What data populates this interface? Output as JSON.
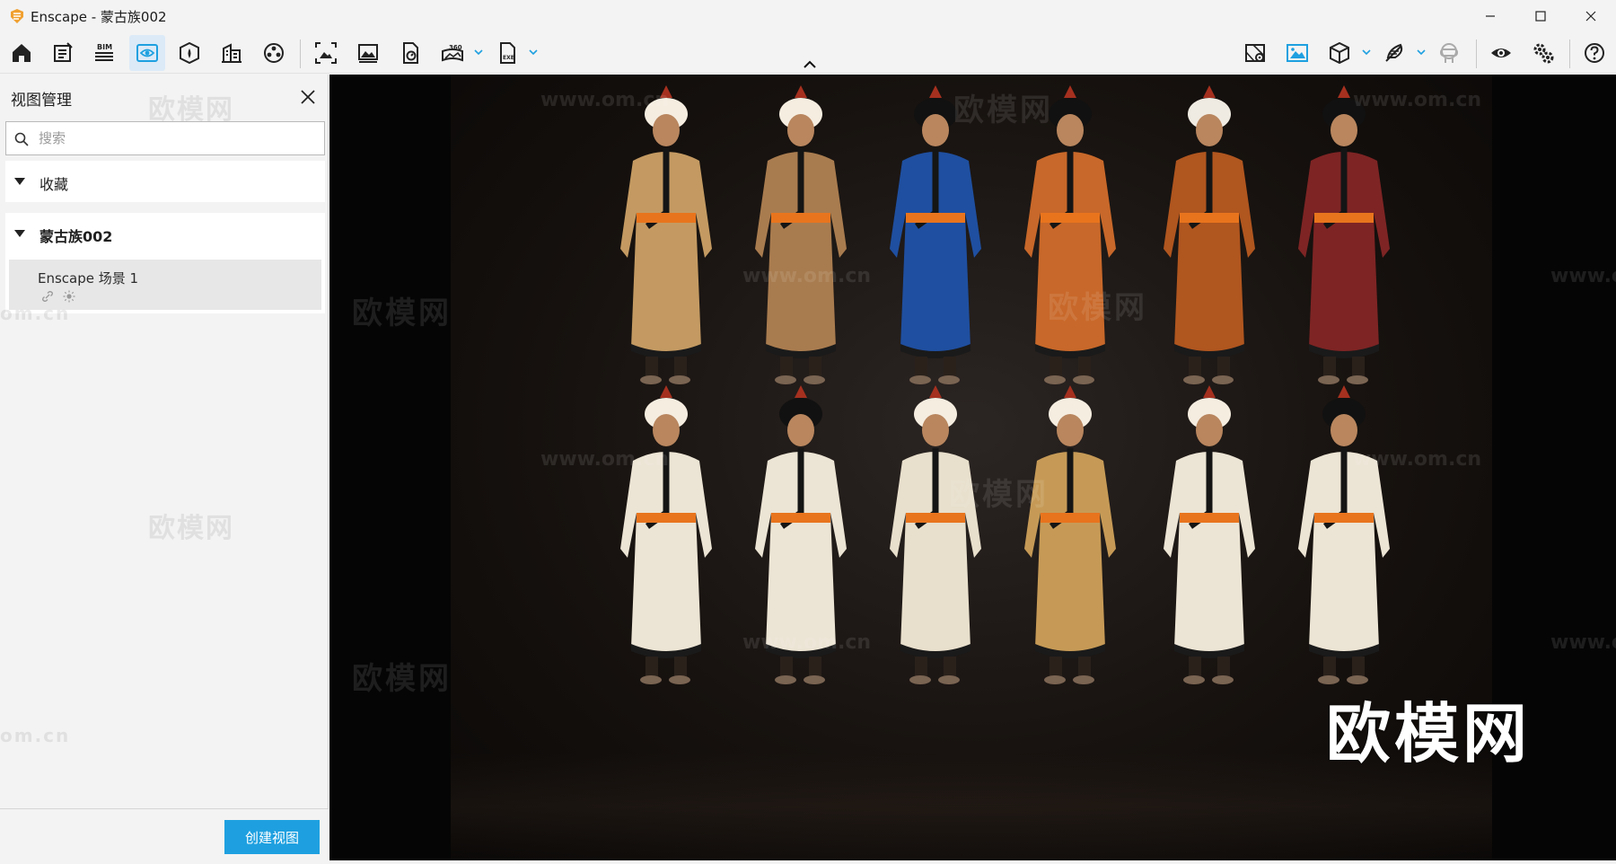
{
  "window": {
    "title": "Enscape - 蒙古族002"
  },
  "panel": {
    "title": "视图管理",
    "search_placeholder": "搜索",
    "sections": [
      {
        "label": "收藏"
      },
      {
        "label": "蒙古族002",
        "items": [
          {
            "name": "Enscape 场景 1"
          }
        ]
      }
    ],
    "create_button": "创建视图"
  },
  "toolbar": {
    "bim_badge": "BIM",
    "pano_badge": "360",
    "exe_badge": "EXE"
  },
  "watermarks": {
    "brand": "欧模网",
    "url": "www.om.cn",
    "url_short": "om.cn"
  },
  "colors": {
    "accent": "#1ea0e0",
    "active_tool_bg": "#dceaf7",
    "logo": "#f0a030"
  },
  "icons": [
    "home-icon",
    "view-manager-icon",
    "bim-icon",
    "views-icon",
    "assets-icon",
    "building-icon",
    "materials-icon",
    "screenshot-icon",
    "batch-render-icon",
    "export-icon",
    "panorama-icon",
    "exe-export-icon",
    "map-icon",
    "image-icon",
    "cube-icon",
    "feather-icon",
    "vr-icon",
    "eye-icon",
    "settings-icon",
    "help-icon"
  ]
}
